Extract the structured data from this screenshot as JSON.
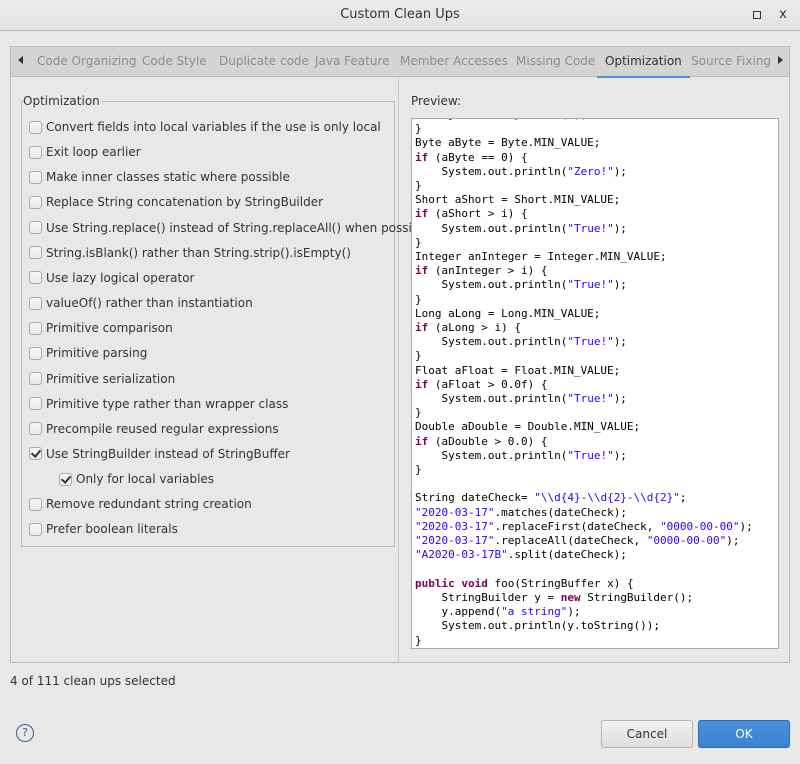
{
  "window": {
    "title": "Custom Clean Ups",
    "maximize_icon": "maximize-icon",
    "close_icon": "close-icon",
    "close_glyph": "x"
  },
  "tabs": [
    {
      "label": "Code Organizing",
      "active": false
    },
    {
      "label": "Code Style",
      "active": false
    },
    {
      "label": "Duplicate code",
      "active": false
    },
    {
      "label": "Java Feature",
      "active": false
    },
    {
      "label": "Member Accesses",
      "active": false
    },
    {
      "label": "Missing Code",
      "active": false
    },
    {
      "label": "Optimization",
      "active": true
    },
    {
      "label": "Source Fixing",
      "active": false
    }
  ],
  "group": {
    "label": "Optimization",
    "options": [
      {
        "label": "Convert fields into local variables if the use is only local",
        "checked": false
      },
      {
        "label": "Exit loop earlier",
        "checked": false
      },
      {
        "label": "Make inner classes static where possible",
        "checked": false
      },
      {
        "label": "Replace String concatenation by StringBuilder",
        "checked": false
      },
      {
        "label": "Use String.replace() instead of String.replaceAll() when possible",
        "checked": false
      },
      {
        "label": "String.isBlank() rather than String.strip().isEmpty()",
        "checked": false
      },
      {
        "label": "Use lazy logical operator",
        "checked": false
      },
      {
        "label": "valueOf() rather than instantiation",
        "checked": false
      },
      {
        "label": "Primitive comparison",
        "checked": false
      },
      {
        "label": "Primitive parsing",
        "checked": false
      },
      {
        "label": "Primitive serialization",
        "checked": false
      },
      {
        "label": "Primitive type rather than wrapper class",
        "checked": false
      },
      {
        "label": "Precompile reused regular expressions",
        "checked": false
      },
      {
        "label": "Use StringBuilder instead of StringBuffer",
        "checked": true
      },
      {
        "label": "Only for local variables",
        "checked": true,
        "indent": true
      },
      {
        "label": "Remove redundant string creation",
        "checked": false
      },
      {
        "label": "Prefer boolean literals",
        "checked": false
      }
    ]
  },
  "preview": {
    "label": "Preview:",
    "code_lines": [
      [
        [
          "p",
          "    System.out.println(i);"
        ]
      ],
      [
        [
          "p",
          "}"
        ]
      ],
      [
        [
          "p",
          "Byte aByte = Byte.MIN_VALUE;"
        ]
      ],
      [
        [
          "k",
          "if"
        ],
        [
          "p",
          " (aByte == 0) {"
        ]
      ],
      [
        [
          "p",
          "    System.out.println("
        ],
        [
          "s",
          "\"Zero!\""
        ],
        [
          "p",
          ");"
        ]
      ],
      [
        [
          "p",
          "}"
        ]
      ],
      [
        [
          "p",
          "Short aShort = Short.MIN_VALUE;"
        ]
      ],
      [
        [
          "k",
          "if"
        ],
        [
          "p",
          " (aShort > i) {"
        ]
      ],
      [
        [
          "p",
          "    System.out.println("
        ],
        [
          "s",
          "\"True!\""
        ],
        [
          "p",
          ");"
        ]
      ],
      [
        [
          "p",
          "}"
        ]
      ],
      [
        [
          "p",
          "Integer anInteger = Integer.MIN_VALUE;"
        ]
      ],
      [
        [
          "k",
          "if"
        ],
        [
          "p",
          " (anInteger > i) {"
        ]
      ],
      [
        [
          "p",
          "    System.out.println("
        ],
        [
          "s",
          "\"True!\""
        ],
        [
          "p",
          ");"
        ]
      ],
      [
        [
          "p",
          "}"
        ]
      ],
      [
        [
          "p",
          "Long aLong = Long.MIN_VALUE;"
        ]
      ],
      [
        [
          "k",
          "if"
        ],
        [
          "p",
          " (aLong > i) {"
        ]
      ],
      [
        [
          "p",
          "    System.out.println("
        ],
        [
          "s",
          "\"True!\""
        ],
        [
          "p",
          ");"
        ]
      ],
      [
        [
          "p",
          "}"
        ]
      ],
      [
        [
          "p",
          "Float aFloat = Float.MIN_VALUE;"
        ]
      ],
      [
        [
          "k",
          "if"
        ],
        [
          "p",
          " (aFloat > 0.0f) {"
        ]
      ],
      [
        [
          "p",
          "    System.out.println("
        ],
        [
          "s",
          "\"True!\""
        ],
        [
          "p",
          ");"
        ]
      ],
      [
        [
          "p",
          "}"
        ]
      ],
      [
        [
          "p",
          "Double aDouble = Double.MIN_VALUE;"
        ]
      ],
      [
        [
          "k",
          "if"
        ],
        [
          "p",
          " (aDouble > 0.0) {"
        ]
      ],
      [
        [
          "p",
          "    System.out.println("
        ],
        [
          "s",
          "\"True!\""
        ],
        [
          "p",
          ");"
        ]
      ],
      [
        [
          "p",
          "}"
        ]
      ],
      [
        [
          "p",
          ""
        ]
      ],
      [
        [
          "p",
          "String dateCheck= "
        ],
        [
          "s",
          "\"\\\\d{4}-\\\\d{2}-\\\\d{2}\""
        ],
        [
          "p",
          ";"
        ]
      ],
      [
        [
          "s",
          "\"2020-03-17\""
        ],
        [
          "p",
          ".matches(dateCheck);"
        ]
      ],
      [
        [
          "s",
          "\"2020-03-17\""
        ],
        [
          "p",
          ".replaceFirst(dateCheck, "
        ],
        [
          "s",
          "\"0000-00-00\""
        ],
        [
          "p",
          ");"
        ]
      ],
      [
        [
          "s",
          "\"2020-03-17\""
        ],
        [
          "p",
          ".replaceAll(dateCheck, "
        ],
        [
          "s",
          "\"0000-00-00\""
        ],
        [
          "p",
          ");"
        ]
      ],
      [
        [
          "s",
          "\"A2020-03-17B\""
        ],
        [
          "p",
          ".split(dateCheck);"
        ]
      ],
      [
        [
          "p",
          ""
        ]
      ],
      [
        [
          "k",
          "public"
        ],
        [
          "p",
          " "
        ],
        [
          "k",
          "void"
        ],
        [
          "p",
          " foo(StringBuffer x) {"
        ]
      ],
      [
        [
          "p",
          "    StringBuilder y = "
        ],
        [
          "k",
          "new"
        ],
        [
          "p",
          " StringBuilder();"
        ]
      ],
      [
        [
          "p",
          "    y.append("
        ],
        [
          "s",
          "\"a string\""
        ],
        [
          "p",
          ");"
        ]
      ],
      [
        [
          "p",
          "    System.out.println(y.toString());"
        ]
      ],
      [
        [
          "p",
          "}"
        ]
      ]
    ]
  },
  "status": "4 of 111 clean ups selected",
  "buttons": {
    "help_glyph": "?",
    "cancel": "Cancel",
    "ok": "OK"
  }
}
